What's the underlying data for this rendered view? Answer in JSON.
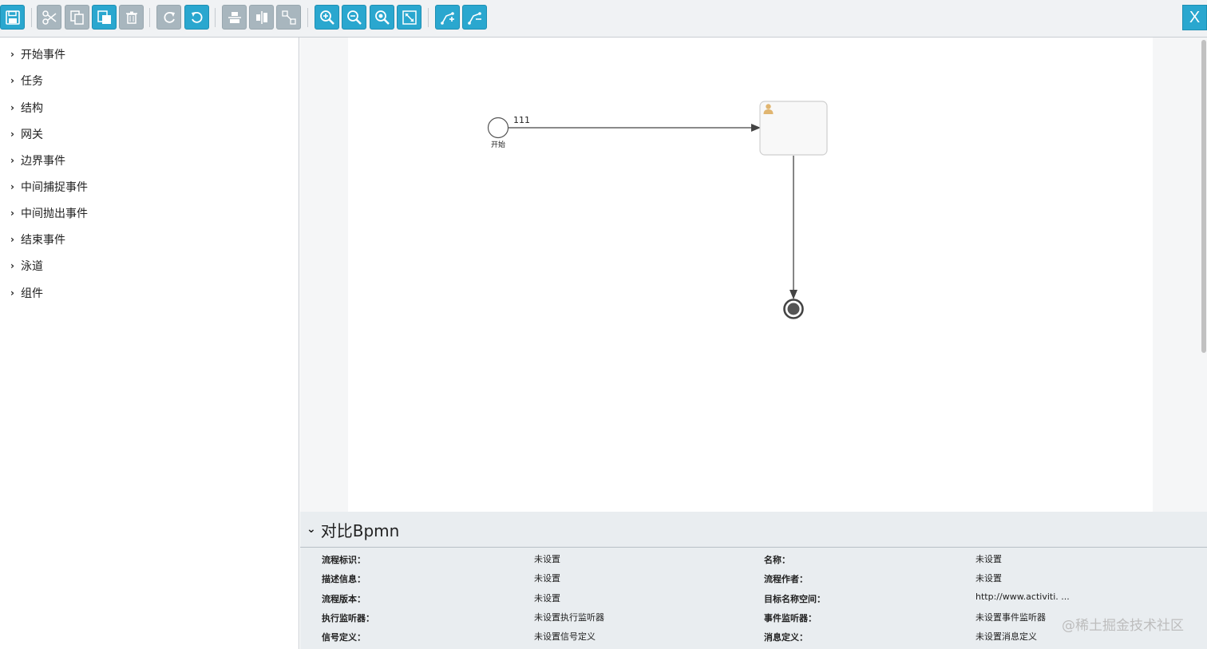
{
  "toolbar": {
    "buttons": [
      {
        "name": "save",
        "state": "active",
        "icon": "floppy-icon"
      },
      {
        "name": "cut",
        "state": "disabled",
        "icon": "scissors-icon"
      },
      {
        "name": "copy",
        "state": "disabled",
        "icon": "copy-icon"
      },
      {
        "name": "paste",
        "state": "active",
        "icon": "paste-icon"
      },
      {
        "name": "delete",
        "state": "disabled",
        "icon": "trash-icon"
      },
      {
        "name": "redo",
        "state": "disabled",
        "icon": "redo-icon"
      },
      {
        "name": "undo",
        "state": "active",
        "icon": "undo-icon"
      },
      {
        "name": "align-horizontal",
        "state": "disabled",
        "icon": "align-horizontal-icon"
      },
      {
        "name": "align-vertical",
        "state": "disabled",
        "icon": "align-vertical-icon"
      },
      {
        "name": "same-size",
        "state": "disabled",
        "icon": "same-size-icon"
      },
      {
        "name": "zoom-in",
        "state": "active",
        "icon": "zoom-in-icon"
      },
      {
        "name": "zoom-out",
        "state": "active",
        "icon": "zoom-out-icon"
      },
      {
        "name": "zoom-actual",
        "state": "active",
        "icon": "zoom-actual-icon"
      },
      {
        "name": "zoom-fit",
        "state": "active",
        "icon": "fit-icon"
      },
      {
        "name": "add-bendpoint",
        "state": "active",
        "icon": "add-bendpoint-icon"
      },
      {
        "name": "remove-bendpoint",
        "state": "active",
        "icon": "remove-bendpoint-icon"
      }
    ],
    "close_label": "X",
    "colors": {
      "active": "#2aa7cf",
      "disabled": "#a8b6be"
    }
  },
  "sidebar": {
    "items": [
      {
        "label": "开始事件"
      },
      {
        "label": "任务"
      },
      {
        "label": "结构"
      },
      {
        "label": "网关"
      },
      {
        "label": "边界事件"
      },
      {
        "label": "中间捕捉事件"
      },
      {
        "label": "中间抛出事件"
      },
      {
        "label": "结束事件"
      },
      {
        "label": "泳道"
      },
      {
        "label": "组件"
      }
    ]
  },
  "diagram": {
    "start_event_label": "开始",
    "flow_label": "111",
    "user_task_label": ""
  },
  "properties": {
    "title": "对比Bpmn",
    "rows": [
      {
        "l1": "流程标识：",
        "v1": "未设置",
        "l2": "名称：",
        "v2": "未设置"
      },
      {
        "l1": "描述信息：",
        "v1": "未设置",
        "l2": "流程作者：",
        "v2": "未设置"
      },
      {
        "l1": "流程版本：",
        "v1": "未设置",
        "l2": "目标名称空间：",
        "v2": "http://www.activiti. ..."
      },
      {
        "l1": "执行监听器：",
        "v1": "未设置执行监听器",
        "l2": "事件监听器：",
        "v2": "未设置事件监听器"
      },
      {
        "l1": "信号定义：",
        "v1": "未设置信号定义",
        "l2": "消息定义：",
        "v2": "未设置消息定义"
      }
    ]
  },
  "watermark": "@稀土掘金技术社区"
}
